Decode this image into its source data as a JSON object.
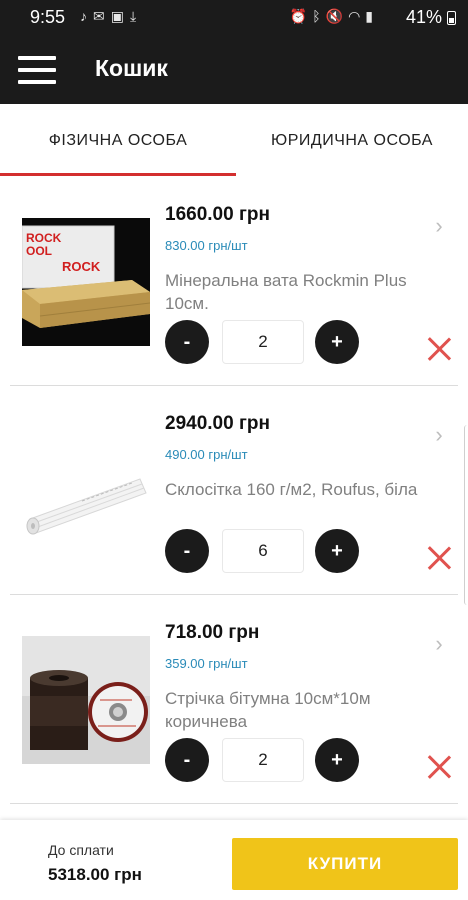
{
  "status_bar": {
    "time": "9:55",
    "battery": "41%",
    "left_icons": [
      "music-icon",
      "mail-icon",
      "image-icon",
      "download-icon"
    ],
    "right_icons": [
      "alarm-icon",
      "bluetooth-icon",
      "mute-icon",
      "wifi-icon",
      "signal-icon"
    ]
  },
  "app_bar": {
    "title": "Кошик",
    "menu_icon": "hamburger-menu-icon"
  },
  "tabs": [
    {
      "label": "ФІЗИЧНА ОСОБА",
      "selected": true
    },
    {
      "label": "ЮРИДИЧНА ОСОБА",
      "selected": false
    }
  ],
  "cart": {
    "items": [
      {
        "price": "1660.00 грн",
        "unit_price": "830.00 грн/шт",
        "name": "Мінеральна вата Rockmin Plus 10см.",
        "quantity": "2",
        "minus_label": "-",
        "plus_label": "+",
        "image": "mineral-wool-image"
      },
      {
        "price": "2940.00 грн",
        "unit_price": "490.00 грн/шт",
        "name": "Склосітка 160 г/м2, Roufus, біла",
        "quantity": "6",
        "minus_label": "-",
        "plus_label": "+",
        "image": "fiberglass-mesh-roll-image"
      },
      {
        "price": "718.00 грн",
        "unit_price": "359.00 грн/шт",
        "name": "Стрічка бітумна 10см*10м коричнева",
        "quantity": "2",
        "minus_label": "-",
        "plus_label": "+",
        "image": "bitumen-tape-image"
      }
    ]
  },
  "footer": {
    "total_label": "До сплати",
    "total_value": "5318.00 грн",
    "buy_label": "КУПИТИ"
  },
  "colors": {
    "app_bar": "#1b1b1b",
    "tab_indicator": "#d32f2f",
    "unit_price": "#2a8bb8",
    "remove": "#e0524e",
    "buy_button": "#f0c419"
  }
}
